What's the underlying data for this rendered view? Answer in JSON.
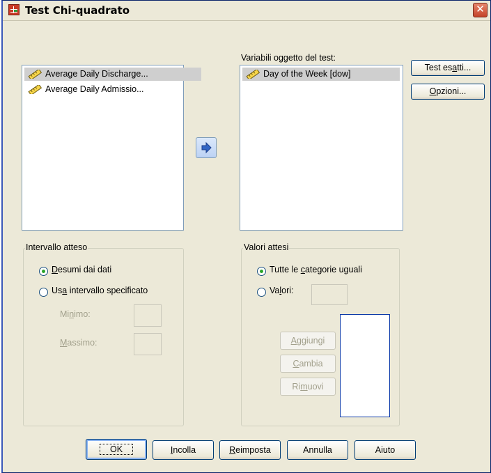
{
  "window": {
    "title": "Test Chi-quadrato",
    "close_glyph": "✕"
  },
  "source_list": {
    "items": [
      {
        "label": "Average Daily Discharge...",
        "icon": "ruler-icon",
        "selected": true
      },
      {
        "label": "Average Daily Admissio...",
        "icon": "ruler-icon",
        "selected": false
      }
    ]
  },
  "test_variables": {
    "label": "Variabili oggetto del test:",
    "items": [
      {
        "label": "Day of the Week [dow]",
        "icon": "ruler-icon",
        "selected": true
      }
    ]
  },
  "side_buttons": {
    "exact": "Test esatti...",
    "options": "Opzioni..."
  },
  "expected_range": {
    "title": "Intervallo atteso",
    "option_data": "Desumi dai dati",
    "option_specified": "Usa intervallo specificato",
    "min_label": "Minimo:",
    "max_label": "Massimo:",
    "selected": "data"
  },
  "expected_values": {
    "title": "Valori attesi",
    "option_equal": "Tutte le categorie uguali",
    "option_values": "Valori:",
    "add": "Aggiungi",
    "change": "Cambia",
    "remove": "Rimuovi",
    "selected": "equal"
  },
  "footer": {
    "ok": "OK",
    "paste": "Incolla",
    "reset": "Reimposta",
    "cancel": "Annulla",
    "help": "Aiuto"
  },
  "colors": {
    "accent": "#316ac5",
    "title_close": "#c34329",
    "radio_dot": "#2aa52a"
  }
}
